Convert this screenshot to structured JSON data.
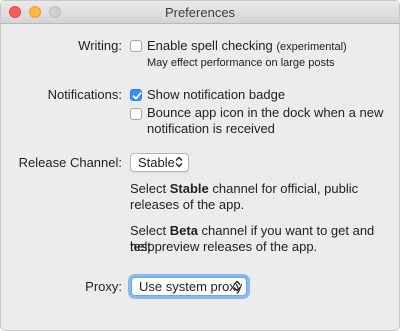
{
  "window": {
    "title": "Preferences"
  },
  "writing": {
    "label": "Writing:",
    "spellcheck_label": "Enable spell checking",
    "spellcheck_note": "(experimental)",
    "spellcheck_hint": "May effect performance on large posts",
    "spellcheck_checked": false
  },
  "notifications": {
    "label": "Notifications:",
    "badge_label": "Show notification badge",
    "badge_checked": true,
    "bounce_label_line1": "Bounce app icon in the dock when a new",
    "bounce_label_line2": "notification is received",
    "bounce_checked": false
  },
  "release": {
    "label": "Release Channel:",
    "selected": "Stable",
    "stable_desc_pre": "Select ",
    "stable_desc_bold": "Stable",
    "stable_desc_post": " channel for official, public",
    "stable_desc_line2": "releases of the app.",
    "beta_desc_pre": "Select ",
    "beta_desc_bold": "Beta",
    "beta_desc_post": " channel if you want to get and help",
    "beta_desc_line2": "test preview releases of the app."
  },
  "proxy": {
    "label": "Proxy:",
    "selected": "Use system proxy"
  },
  "colors": {
    "accent": "#3b8ff6"
  }
}
